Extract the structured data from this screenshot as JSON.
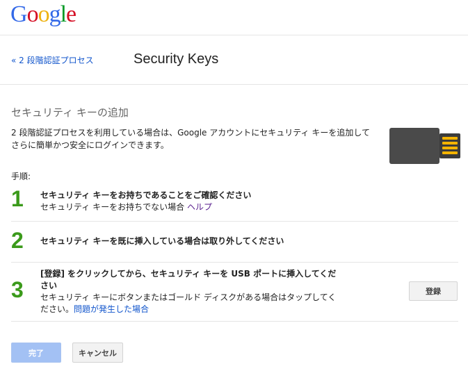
{
  "header": {
    "logo_text": "Google",
    "logo_colors": [
      "#3369e8",
      "#d50f25",
      "#eeb211",
      "#3369e8",
      "#009925",
      "#d50f25"
    ],
    "back_link": "« 2 段階認証プロセス",
    "title": "Security Keys"
  },
  "main": {
    "section_title": "セキュリティ キーの追加",
    "intro": "2 段階認証プロセスを利用している場合は、Google アカウントにセキュリティ キーを追加してさらに簡単かつ安全にログインできます。",
    "steps_label": "手順:",
    "steps": [
      {
        "number": "1",
        "title": "セキュリティ キーをお持ちであることをご確認ください",
        "sub": "セキュリティ キーをお持ちでない場合",
        "link": "ヘルプ"
      },
      {
        "number": "2",
        "title": "セキュリティ キーを既に挿入している場合は取り外してください"
      },
      {
        "number": "3",
        "title": "[登録] をクリックしてから、セキュリティ キーを USB ポートに挿入してください",
        "sub": "セキュリティ キーにボタンまたはゴールド ディスクがある場合はタップしてください。",
        "link": "問題が発生した場合",
        "button": "登録"
      }
    ]
  },
  "footer": {
    "done_label": "完了",
    "cancel_label": "キャンセル"
  },
  "colors": {
    "step_number": "#3b9a1b",
    "link": "#1155cc",
    "visited_link": "#551a8b",
    "primary_disabled": "#a3c1f4"
  },
  "icons": {
    "security_key": "usb-security-key-icon"
  }
}
